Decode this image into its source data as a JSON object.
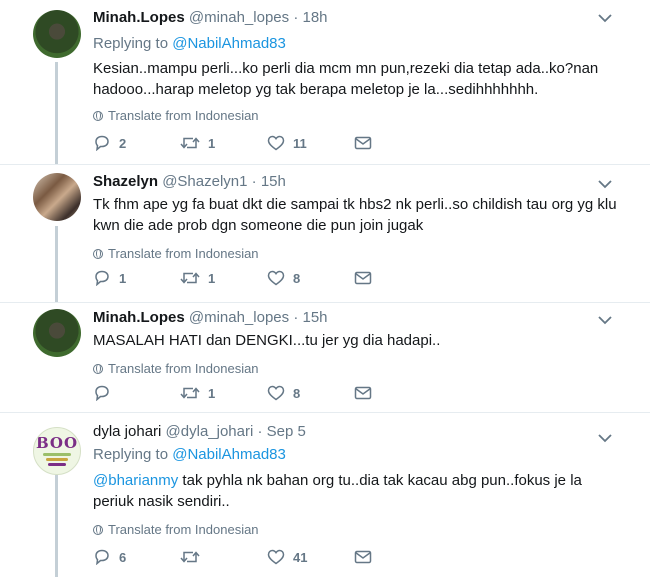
{
  "tweets": [
    {
      "name": "Minah.Lopes",
      "handle": "@minah_lopes",
      "time": "· 18h",
      "replying_prefix": "Replying to",
      "replying_to": "@NabilAhmad83",
      "text": "Kesian..mampu perli...ko perli dia mcm mn pun,rezeki dia tetap ada..ko?nan hadooo...harap meletop yg tak berapa meletop je la...sedihhhhhhh.",
      "translate": "Translate from Indonesian",
      "replies": "2",
      "retweets": "1",
      "likes": "11"
    },
    {
      "name": "Shazelyn",
      "handle": "@Shazelyn1",
      "time": "· 15h",
      "text": "Tk fhm ape yg fa buat dkt die sampai tk hbs2 nk perli..so childish tau org yg klu kwn die ade prob dgn someone die pun join jugak",
      "translate": "Translate from Indonesian",
      "replies": "1",
      "retweets": "1",
      "likes": "8"
    },
    {
      "name": "Minah.Lopes",
      "handle": "@minah_lopes",
      "time": "· 15h",
      "text": "MASALAH HATI dan DENGKI...tu jer yg dia hadapi..",
      "translate": "Translate from Indonesian",
      "replies": "",
      "retweets": "1",
      "likes": "8"
    },
    {
      "name": "dyla johari",
      "handle": "@dyla_johari",
      "time": "· Sep 5",
      "avatar_text": "BOO",
      "replying_prefix": "Replying to",
      "replying_to": "@NabilAhmad83",
      "text_mention": "@bharianmy",
      "text": " tak pyhla nk bahan org tu..dia tak kacau abg pun..fokus je la periuk nasik sendiri..",
      "translate": "Translate from Indonesian",
      "replies": "6",
      "retweets": "",
      "likes": "41"
    }
  ],
  "colors": {
    "link": "#1b95e0",
    "secondary_text": "#657786",
    "thread_line": "#c4cfd6",
    "divider": "#e6ecf0"
  },
  "icons": [
    "reply-icon",
    "retweet-icon",
    "like-icon",
    "message-icon",
    "chevron-down-icon",
    "globe-icon"
  ]
}
